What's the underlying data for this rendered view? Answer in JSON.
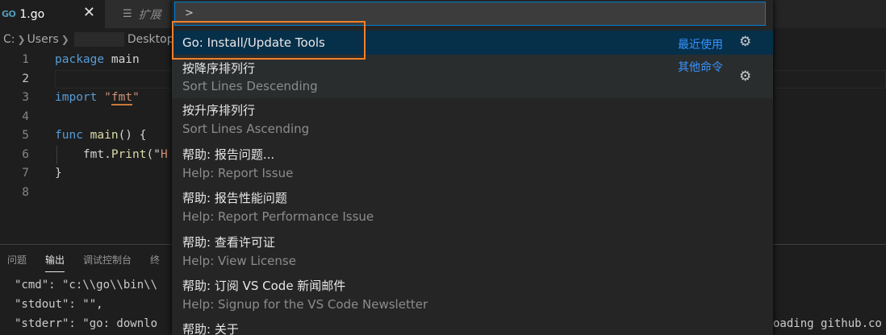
{
  "tabs": {
    "active": {
      "icon": "go-file-icon",
      "icon_text": "GO",
      "label": "1.go",
      "close": "✕"
    },
    "inactive": {
      "icon": "extension-page-icon",
      "label": "扩展"
    }
  },
  "breadcrumb": {
    "drive": "C:",
    "users": "Users",
    "desktop": "Desktop"
  },
  "editor": {
    "lines": [
      {
        "n": "1"
      },
      {
        "n": "2"
      },
      {
        "n": "3"
      },
      {
        "n": "4"
      },
      {
        "n": "5"
      },
      {
        "n": "6"
      },
      {
        "n": "7"
      },
      {
        "n": "8"
      }
    ],
    "code": {
      "l1_kw": "package",
      "l1_rest": " main",
      "l3_kw": "import",
      "l3_str_open": " \"",
      "l3_str_mid": "fmt",
      "l3_str_close": "\"",
      "l5_kw": "func",
      "l5_fn": " main",
      "l5_rest": "() {",
      "l6_pre": "    fmt.",
      "l6_fn": "Print",
      "l6_rest": "(\"",
      "l6_str": "H",
      "l7": "}"
    }
  },
  "panel": {
    "tabs": [
      "问题",
      "输出",
      "调试控制台",
      "终"
    ],
    "lines": [
      "\"cmd\": \"c:\\\\go\\\\bin\\\\",
      "\"stdout\": \"\",",
      "\"stderr\": \"go: downlo"
    ],
    "right_fragment": "oading github.co"
  },
  "quickpick": {
    "input_value": ">",
    "items": [
      {
        "label": "Go: Install/Update Tools",
        "tag": "最近使用"
      },
      {
        "label": "按降序排列行",
        "detail": "Sort Lines Descending",
        "tag": "其他命令"
      },
      {
        "label": "按升序排列行",
        "detail": "Sort Lines Ascending"
      },
      {
        "label": "帮助: 报告问题...",
        "detail": "Help: Report Issue"
      },
      {
        "label": "帮助: 报告性能问题",
        "detail": "Help: Report Performance Issue"
      },
      {
        "label": "帮助: 查看许可证",
        "detail": "Help: View License"
      },
      {
        "label": "帮助: 订阅 VS Code 新闻邮件",
        "detail": "Help: Signup for the VS Code Newsletter"
      },
      {
        "label": "帮助: 关于"
      }
    ]
  },
  "colors": {
    "accent": "#007fd4",
    "selected_row": "#062f4a",
    "annotation": "#f0802a",
    "keyword": "#569cd6",
    "string": "#ce9178",
    "function": "#dcdcaa",
    "tag": "#3794ff"
  }
}
